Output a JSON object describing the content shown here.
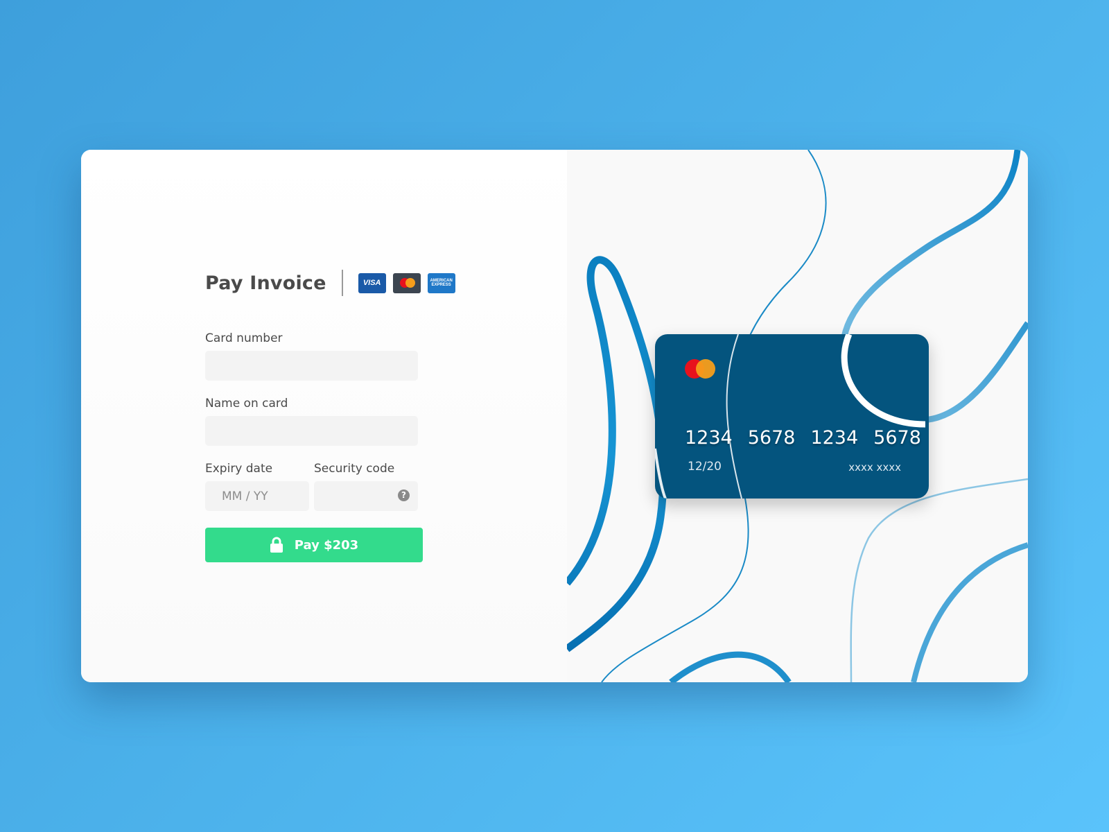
{
  "form": {
    "title": "Pay Invoice",
    "logos": [
      {
        "name": "visa-logo",
        "text": "VISA"
      },
      {
        "name": "mastercard-logo"
      },
      {
        "name": "amex-logo",
        "text_top": "AMERICAN",
        "text_bottom": "EXPRESS"
      }
    ],
    "card_number": {
      "label": "Card number",
      "value": "",
      "placeholder": ""
    },
    "name_on_card": {
      "label": "Name on card",
      "value": "",
      "placeholder": ""
    },
    "expiry": {
      "label": "Expiry date",
      "value": "",
      "placeholder": "MM / YY"
    },
    "security_code": {
      "label": "Security code",
      "value": "",
      "placeholder": "",
      "help_icon": "question-circle-icon",
      "help_glyph": "?"
    },
    "pay_button": {
      "label": "Pay $203",
      "icon": "lock-icon"
    }
  },
  "card_preview": {
    "brand": "mastercard",
    "number_groups": [
      "1234",
      "5678",
      "1234",
      "5678"
    ],
    "expiry": "12/20",
    "name": "xxxx xxxx"
  },
  "colors": {
    "background_start": "#3e9fdc",
    "background_end": "#5ac3fb",
    "card": "#04547e",
    "pay_button": "#33db8c",
    "wave": "#0a86c8",
    "mastercard_red": "#e8121d",
    "mastercard_orange": "#f79e1b"
  }
}
